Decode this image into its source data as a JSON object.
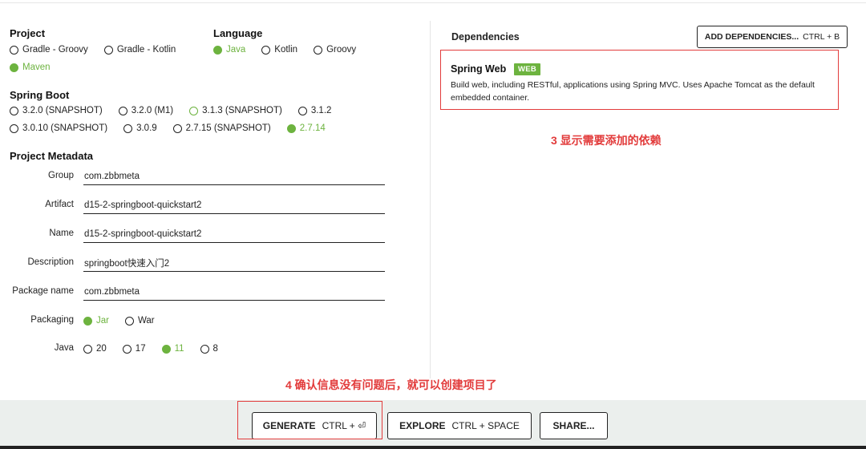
{
  "project": {
    "title": "Project",
    "options": [
      "Gradle - Groovy",
      "Gradle - Kotlin",
      "Maven"
    ],
    "selected": "Maven"
  },
  "language": {
    "title": "Language",
    "options": [
      "Java",
      "Kotlin",
      "Groovy"
    ],
    "selected": "Java"
  },
  "spring_boot": {
    "title": "Spring Boot",
    "options": [
      "3.2.0 (SNAPSHOT)",
      "3.2.0 (M1)",
      "3.1.3 (SNAPSHOT)",
      "3.1.2",
      "3.0.10 (SNAPSHOT)",
      "3.0.9",
      "2.7.15 (SNAPSHOT)",
      "2.7.14"
    ],
    "selected": "2.7.14"
  },
  "metadata": {
    "title": "Project Metadata",
    "group_label": "Group",
    "group_value": "com.zbbmeta",
    "artifact_label": "Artifact",
    "artifact_value": "d15-2-springboot-quickstart2",
    "name_label": "Name",
    "name_value": "d15-2-springboot-quickstart2",
    "description_label": "Description",
    "description_value": "springboot快速入门2",
    "package_label": "Package name",
    "package_value": "com.zbbmeta",
    "packaging_label": "Packaging",
    "packaging_options": [
      "Jar",
      "War"
    ],
    "packaging_selected": "Jar",
    "java_label": "Java",
    "java_options": [
      "20",
      "17",
      "11",
      "8"
    ],
    "java_selected": "11"
  },
  "dependencies": {
    "title": "Dependencies",
    "add_button_label": "ADD DEPENDENCIES...",
    "add_button_shortcut": "CTRL + B",
    "items": [
      {
        "name": "Spring Web",
        "badge": "WEB",
        "description": "Build web, including RESTful, applications using Spring MVC. Uses Apache Tomcat as the default embedded container."
      }
    ]
  },
  "annotations": {
    "step3": "3   显示需要添加的依赖",
    "step4": "4 确认信息没有问题后，就可以创建项目了"
  },
  "footer": {
    "generate_label": "GENERATE",
    "generate_shortcut": "CTRL + ⏎",
    "explore_label": "EXPLORE",
    "explore_shortcut": "CTRL + SPACE",
    "share_label": "SHARE..."
  },
  "colors": {
    "accent_green": "#6db33f",
    "annotation_red": "#e23b3b",
    "footer_bg": "#ebefed"
  }
}
